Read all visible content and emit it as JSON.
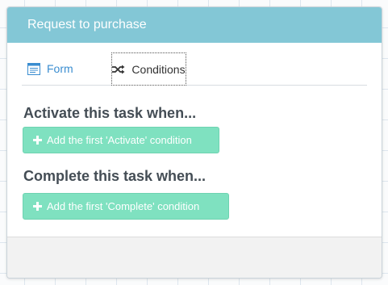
{
  "dialog": {
    "title": "Request to purchase"
  },
  "tabs": [
    {
      "label": "Form",
      "icon": "form-icon",
      "active": false
    },
    {
      "label": "Conditions",
      "icon": "shuffle-icon",
      "active": true
    }
  ],
  "sections": {
    "activate": {
      "title": "Activate this task when...",
      "button_label": "Add the first 'Activate' condition"
    },
    "complete": {
      "title": "Complete this task when...",
      "button_label": "Add the first 'Complete' condition"
    }
  },
  "colors": {
    "header": "#83c7d6",
    "button": "#7fe1c0",
    "link": "#3a8dd0"
  }
}
